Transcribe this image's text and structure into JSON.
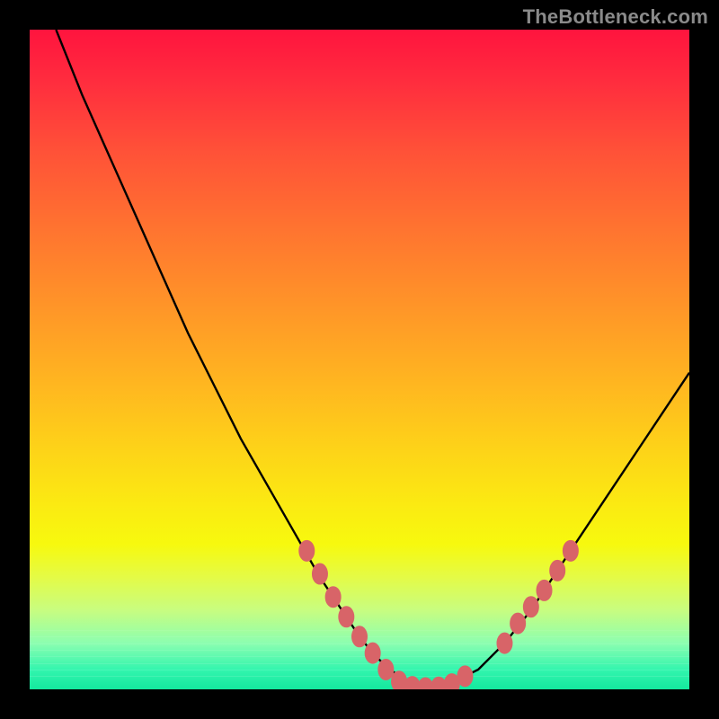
{
  "watermark": "TheBottleneck.com",
  "colors": {
    "frame": "#000000",
    "curve_stroke": "#000000",
    "marker_fill": "#d86468",
    "marker_stroke": "#d86468"
  },
  "chart_data": {
    "type": "line",
    "title": "",
    "xlabel": "",
    "ylabel": "",
    "xlim": [
      0,
      100
    ],
    "ylim": [
      0,
      100
    ],
    "grid": false,
    "curve": {
      "name": "bottleneck-curve",
      "x": [
        4,
        8,
        12,
        16,
        20,
        24,
        28,
        32,
        36,
        40,
        44,
        46,
        48,
        50,
        52,
        54,
        56,
        58,
        60,
        62,
        64,
        68,
        72,
        76,
        80,
        84,
        88,
        92,
        96,
        100
      ],
      "y": [
        100,
        90,
        81,
        72,
        63,
        54,
        46,
        38,
        31,
        24,
        17,
        14,
        11,
        8,
        5.5,
        3.5,
        2,
        1,
        0.5,
        0.5,
        1,
        3,
        7,
        12,
        18,
        24,
        30,
        36,
        42,
        48
      ]
    },
    "markers": {
      "name": "highlighted-points",
      "points": [
        {
          "x": 42,
          "y": 21
        },
        {
          "x": 44,
          "y": 17.5
        },
        {
          "x": 46,
          "y": 14
        },
        {
          "x": 48,
          "y": 11
        },
        {
          "x": 50,
          "y": 8
        },
        {
          "x": 52,
          "y": 5.5
        },
        {
          "x": 54,
          "y": 3
        },
        {
          "x": 56,
          "y": 1.2
        },
        {
          "x": 58,
          "y": 0.4
        },
        {
          "x": 60,
          "y": 0.2
        },
        {
          "x": 62,
          "y": 0.3
        },
        {
          "x": 64,
          "y": 0.8
        },
        {
          "x": 66,
          "y": 2
        },
        {
          "x": 72,
          "y": 7
        },
        {
          "x": 74,
          "y": 10
        },
        {
          "x": 76,
          "y": 12.5
        },
        {
          "x": 78,
          "y": 15
        },
        {
          "x": 80,
          "y": 18
        },
        {
          "x": 82,
          "y": 21
        }
      ],
      "radius": 10
    },
    "horizontal_bands_y": [
      2,
      3,
      4,
      5,
      6,
      7,
      8,
      9
    ]
  }
}
